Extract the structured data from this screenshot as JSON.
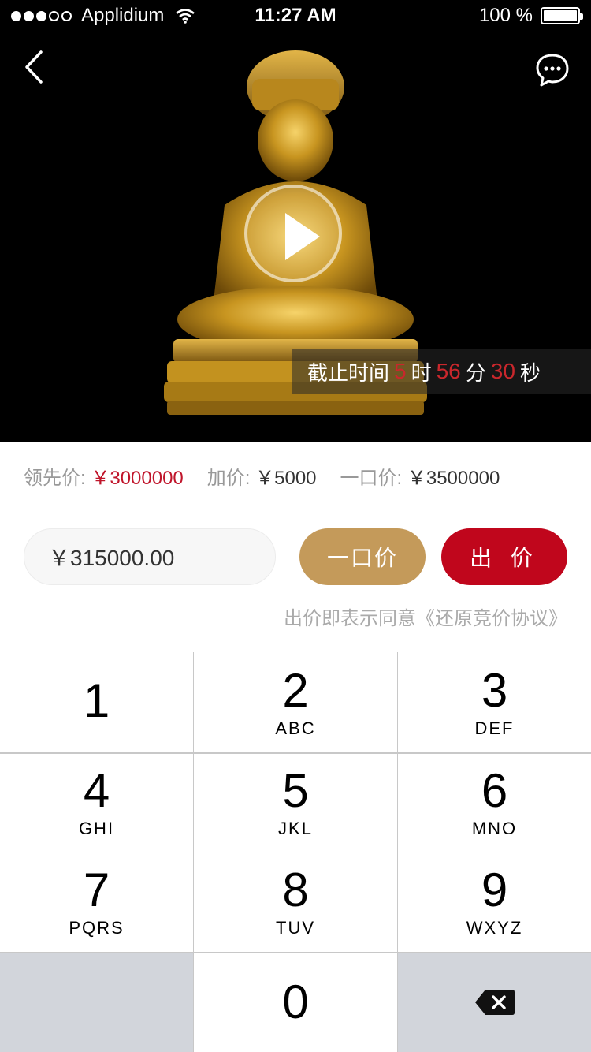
{
  "status_bar": {
    "carrier": "Applidium",
    "time": "11:27 AM",
    "battery_text": "100 %"
  },
  "hero": {
    "back_icon": "chevron-left-icon",
    "chat_icon": "chat-bubble-icon",
    "play_icon": "play-icon",
    "countdown": {
      "label": "截止时间",
      "hours": "5",
      "hours_unit": "时",
      "minutes": "56",
      "minutes_unit": "分",
      "seconds": "30",
      "seconds_unit": "秒"
    }
  },
  "prices": {
    "leading_label": "领先价:",
    "leading_value": "￥3000000",
    "increment_label": "加价:",
    "increment_value": "￥5000",
    "buynow_label": "一口价:",
    "buynow_value": "￥3500000"
  },
  "bid": {
    "input_value": "￥315000.00",
    "buynow_button": "一口价",
    "bid_button": "出 价",
    "agreement_text": "出价即表示同意《还原竞价协议》"
  },
  "keypad": {
    "keys": [
      {
        "digit": "1",
        "letters": ""
      },
      {
        "digit": "2",
        "letters": "ABC"
      },
      {
        "digit": "3",
        "letters": "DEF"
      },
      {
        "digit": "4",
        "letters": "GHI"
      },
      {
        "digit": "5",
        "letters": "JKL"
      },
      {
        "digit": "6",
        "letters": "MNO"
      },
      {
        "digit": "7",
        "letters": "PQRS"
      },
      {
        "digit": "8",
        "letters": "TUV"
      },
      {
        "digit": "9",
        "letters": "WXYZ"
      },
      {
        "digit": "0",
        "letters": ""
      }
    ],
    "backspace_icon": "backspace-icon"
  },
  "colors": {
    "accent_red": "#c0061c",
    "gold": "#c49a5a",
    "countdown_red": "#c9272c"
  }
}
